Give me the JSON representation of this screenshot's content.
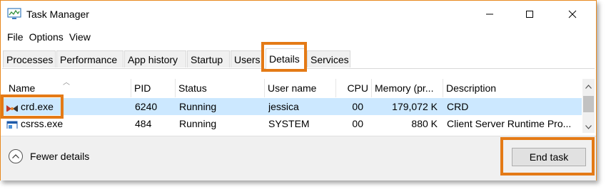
{
  "window": {
    "title": "Task Manager",
    "accent": "#e47a16"
  },
  "menu": [
    "File",
    "Options",
    "View"
  ],
  "tabs": [
    "Processes",
    "Performance",
    "App history",
    "Startup",
    "Users",
    "Details",
    "Services"
  ],
  "active_tab": "Details",
  "columns": [
    "Name",
    "PID",
    "Status",
    "User name",
    "CPU",
    "Memory (pr...",
    "Description"
  ],
  "rows": [
    {
      "name": "crd.exe",
      "pid": "6240",
      "status": "Running",
      "user": "jessica",
      "cpu": "00",
      "memory": "179,072 K",
      "description": "CRD",
      "selected": true,
      "icon": "crd-process-icon"
    },
    {
      "name": "csrss.exe",
      "pid": "484",
      "status": "Running",
      "user": "SYSTEM",
      "cpu": "00",
      "memory": "880 K",
      "description": "Client Server Runtime Pro...",
      "selected": false,
      "icon": "system-process-icon"
    }
  ],
  "footer": {
    "fewer_details": "Fewer details",
    "end_task": "End task"
  }
}
